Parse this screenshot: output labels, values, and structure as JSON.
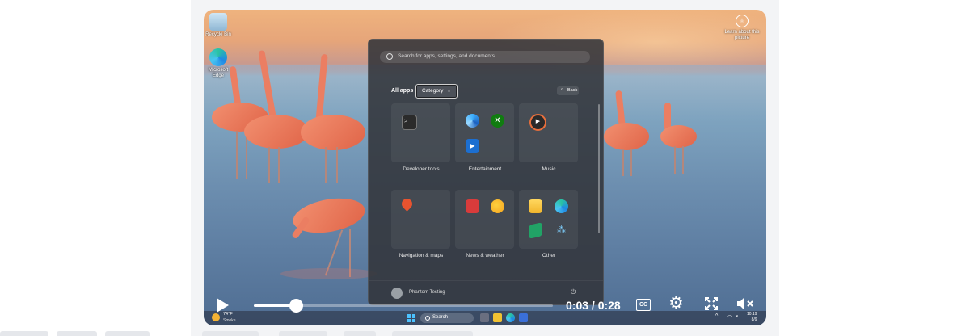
{
  "desktop": {
    "icons": [
      {
        "label": "Recycle Bin",
        "icon": "recycle-bin-icon"
      },
      {
        "label": "Microsoft Edge",
        "icon": "edge-icon"
      }
    ],
    "learn_more": "Learn about this picture"
  },
  "start_menu": {
    "search_placeholder": "Search for apps, settings, and documents",
    "all_apps_label": "All apps",
    "category_label": "Category",
    "back_label": "Back",
    "categories": [
      {
        "label": "Developer tools",
        "icons": [
          "terminal-icon"
        ]
      },
      {
        "label": "Entertainment",
        "icons": [
          "edge-dev-icon",
          "xbox-icon",
          "movies-icon"
        ]
      },
      {
        "label": "Music",
        "icons": [
          "media-player-icon"
        ]
      },
      {
        "label": "Navigation & maps",
        "icons": [
          "maps-icon"
        ]
      },
      {
        "label": "News & weather",
        "icons": [
          "news-icon",
          "weather-icon"
        ]
      },
      {
        "label": "Other",
        "icons": [
          "file-explorer-icon",
          "edge-icon",
          "excel-icon",
          "network-icon"
        ]
      }
    ],
    "user_name": "Phantom Testing"
  },
  "taskbar": {
    "temperature": "74°F",
    "weather_desc": "Smoke",
    "search_label": "Search",
    "clock_time": "10:19",
    "clock_date": "8/9"
  },
  "player": {
    "time_display": "0:03 / 0:28",
    "progress_fraction": 0.14,
    "cc_label": "CC"
  }
}
